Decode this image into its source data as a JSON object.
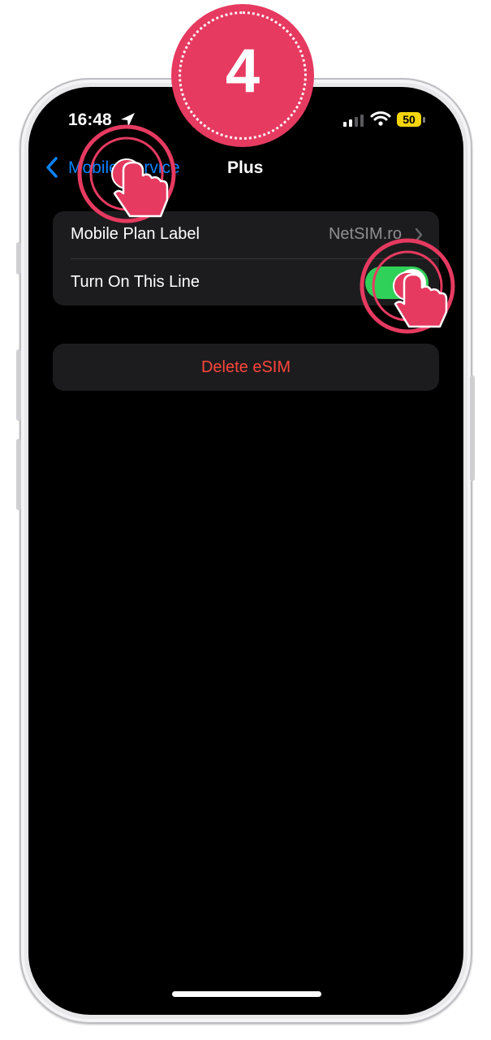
{
  "tutorial": {
    "step_number": "4",
    "accent_color": "#e63a60"
  },
  "status_bar": {
    "time": "16:48",
    "battery_level": "50",
    "icons": [
      "location-arrow-icon",
      "cellular-signal-icon",
      "wifi-icon",
      "battery-icon"
    ]
  },
  "nav_bar": {
    "back_label": "Mobile Service",
    "title": "Plus"
  },
  "settings": {
    "rows": [
      {
        "label": "Mobile Plan Label",
        "value": "NetSIM.ro"
      },
      {
        "label": "Turn On This Line",
        "toggle_on": true
      }
    ],
    "delete_label": "Delete eSIM"
  },
  "colors": {
    "link_blue": "#0a84ff",
    "toggle_green": "#30d158",
    "destructive_red": "#ff453a",
    "cell_background": "#1c1c1e"
  }
}
